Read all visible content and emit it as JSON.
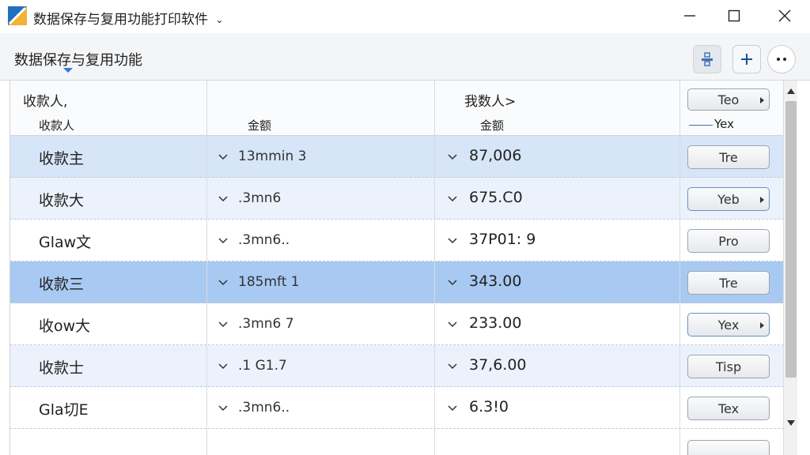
{
  "window": {
    "title": "数据保存与复用功能打印软件",
    "title_chevron": "⌄",
    "icons": {
      "app": "app-logo-icon",
      "minimize": "minimize-icon",
      "maximize": "maximize-icon",
      "close": "close-icon"
    }
  },
  "toolbar": {
    "section_title": "数据保存与复用功能",
    "buttons": [
      {
        "name": "share-button",
        "icon": "share-icon"
      },
      {
        "name": "add-button",
        "icon": "plus-icon",
        "glyph": "+"
      },
      {
        "name": "more-button",
        "icon": "more-icon",
        "glyph": "••"
      }
    ]
  },
  "grid": {
    "header_top": {
      "col1": "收款人,",
      "col3": "我数人>",
      "col4_pill": "Teo"
    },
    "header_sub": {
      "col1": "收款人",
      "col2": "金额",
      "col3": "金额",
      "col4": "Yex"
    },
    "rows": [
      {
        "name": "收款主",
        "amount": "13mmin 3",
        "value": "87,006",
        "action": "Tre",
        "dropdown": false
      },
      {
        "name": "收款大",
        "amount": ".3mn6",
        "value": "675.C0",
        "action": "Yeb",
        "dropdown": true
      },
      {
        "name": "Glaw文",
        "amount": ".3mn6..",
        "value": "37P01: 9",
        "action": "Pro",
        "dropdown": false
      },
      {
        "name": "收款三",
        "amount": "185mft 1",
        "value": "343.00",
        "action": "Tre",
        "dropdown": false
      },
      {
        "name": "收ow大",
        "amount": ".3mn6 7",
        "value": "233.00",
        "action": "Yex",
        "dropdown": true
      },
      {
        "name": "收款士",
        "amount": ".1 G1.7",
        "value": "37,6.00",
        "action": "Tisp",
        "dropdown": false
      },
      {
        "name": "Gla切E",
        "amount": ".3mn6..",
        "value": "6.3!0",
        "action": "Tex",
        "dropdown": false
      }
    ]
  },
  "colors": {
    "selected_row": "#a8c9f1",
    "light_selected_row": "#d6e5f8",
    "alt_row": "#ecf2fb",
    "accent": "#2f7bd6"
  }
}
